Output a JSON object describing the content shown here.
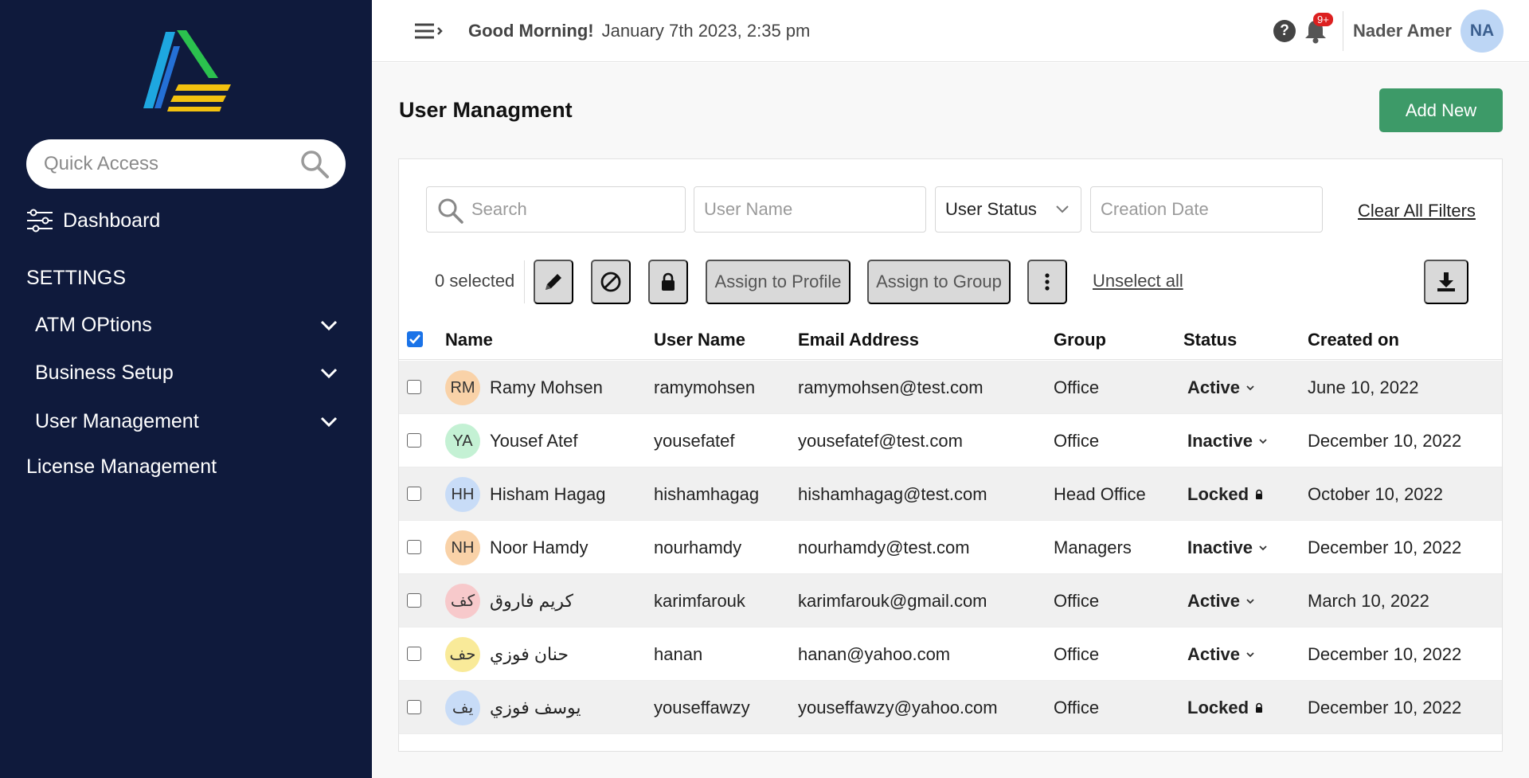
{
  "sidebar": {
    "quick_access_placeholder": "Quick Access",
    "dashboard_label": "Dashboard",
    "settings_label": "SETTINGS",
    "items": [
      {
        "label": "ATM OPtions"
      },
      {
        "label": "Business Setup"
      },
      {
        "label": "User Management"
      }
    ],
    "license_label": "License Management"
  },
  "topbar": {
    "greeting": "Good Morning!",
    "datetime": "January 7th 2023, 2:35 pm",
    "help_glyph": "?",
    "notification_count": "9+",
    "user_name": "Nader Amer",
    "user_initials": "NA"
  },
  "page": {
    "title": "User Managment",
    "add_new_label": "Add New"
  },
  "filters": {
    "search_placeholder": "Search",
    "user_name_placeholder": "User Name",
    "user_status_label": "User Status",
    "creation_date_placeholder": "Creation Date",
    "clear_label": "Clear All Filters"
  },
  "toolbar": {
    "selected_text": "0 selected",
    "assign_profile_label": "Assign to Profile",
    "assign_group_label": "Assign to Group",
    "unselect_label": "Unselect all"
  },
  "table": {
    "headers": {
      "name": "Name",
      "user_name": "User Name",
      "email": "Email Address",
      "group": "Group",
      "status": "Status",
      "created": "Created on"
    },
    "rows": [
      {
        "initials": "RM",
        "avatar_color": "#f9d2a8",
        "name": "Ramy Mohsen",
        "username": "ramymohsen",
        "email": "ramymohsen@test.com",
        "group": "Office",
        "status": "Active",
        "status_icon": "chevron-down-icon",
        "created": "June 10, 2022"
      },
      {
        "initials": "YA",
        "avatar_color": "#c4f1d4",
        "name": "Yousef Atef",
        "username": "yousefatef",
        "email": "yousefatef@test.com",
        "group": "Office",
        "status": "Inactive",
        "status_icon": "chevron-down-icon",
        "created": "December 10, 2022"
      },
      {
        "initials": "HH",
        "avatar_color": "#c8dcf7",
        "name": "Hisham Hagag",
        "username": "hishamhagag",
        "email": "hishamhagag@test.com",
        "group": "Head Office",
        "status": "Locked",
        "status_icon": "lock-icon",
        "created": "October 10, 2022"
      },
      {
        "initials": "NH",
        "avatar_color": "#f9d2a8",
        "name": "Noor Hamdy",
        "username": "nourhamdy",
        "email": "nourhamdy@test.com",
        "group": "Managers",
        "status": "Inactive",
        "status_icon": "chevron-down-icon",
        "created": "December 10, 2022"
      },
      {
        "initials": "كف",
        "avatar_color": "#f7c9cb",
        "name": "كريم فاروق",
        "username": "karimfarouk",
        "email": "karimfarouk@gmail.com",
        "group": "Office",
        "status": "Active",
        "status_icon": "chevron-down-icon",
        "created": "March 10, 2022"
      },
      {
        "initials": "حف",
        "avatar_color": "#f9ea99",
        "name": "حنان فوزي",
        "username": "hanan",
        "email": "hanan@yahoo.com",
        "group": "Office",
        "status": "Active",
        "status_icon": "chevron-down-icon",
        "created": "December 10, 2022"
      },
      {
        "initials": "يف",
        "avatar_color": "#c8dcf7",
        "name": "يوسف فوزي",
        "username": "youseffawzy",
        "email": "youseffawzy@yahoo.com",
        "group": "Office",
        "status": "Locked",
        "status_icon": "lock-icon",
        "created": "December 10, 2022"
      }
    ]
  },
  "colors": {
    "sidebar_bg": "#0f1a3c",
    "accent_green": "#3d9a68",
    "badge_red": "#dc2020",
    "checkbox_blue": "#1a73e8"
  }
}
